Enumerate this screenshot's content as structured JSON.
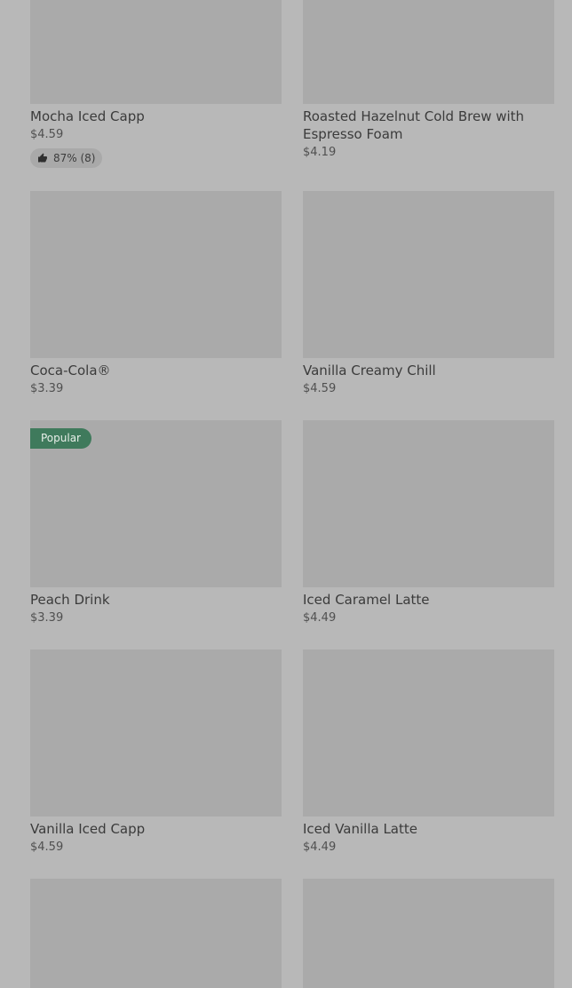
{
  "products": [
    {
      "title": "Mocha Iced Capp",
      "price": "$4.59",
      "rating": "87% (8)"
    },
    {
      "title": "Roasted Hazelnut Cold Brew with Espresso Foam",
      "price": "$4.19"
    },
    {
      "title": "Coca-Cola®",
      "price": "$3.39"
    },
    {
      "title": "Vanilla Creamy Chill",
      "price": "$4.59"
    },
    {
      "title": "Peach Drink",
      "price": "$3.39",
      "badge": "Popular"
    },
    {
      "title": "Iced Caramel Latte",
      "price": "$4.49"
    },
    {
      "title": "Vanilla Iced Capp",
      "price": "$4.59"
    },
    {
      "title": "Iced Vanilla Latte",
      "price": "$4.49"
    }
  ],
  "colors": {
    "background": "#b8b8b8",
    "thumbnail": "#aaaaaa",
    "badge": "#3f7a5c"
  }
}
